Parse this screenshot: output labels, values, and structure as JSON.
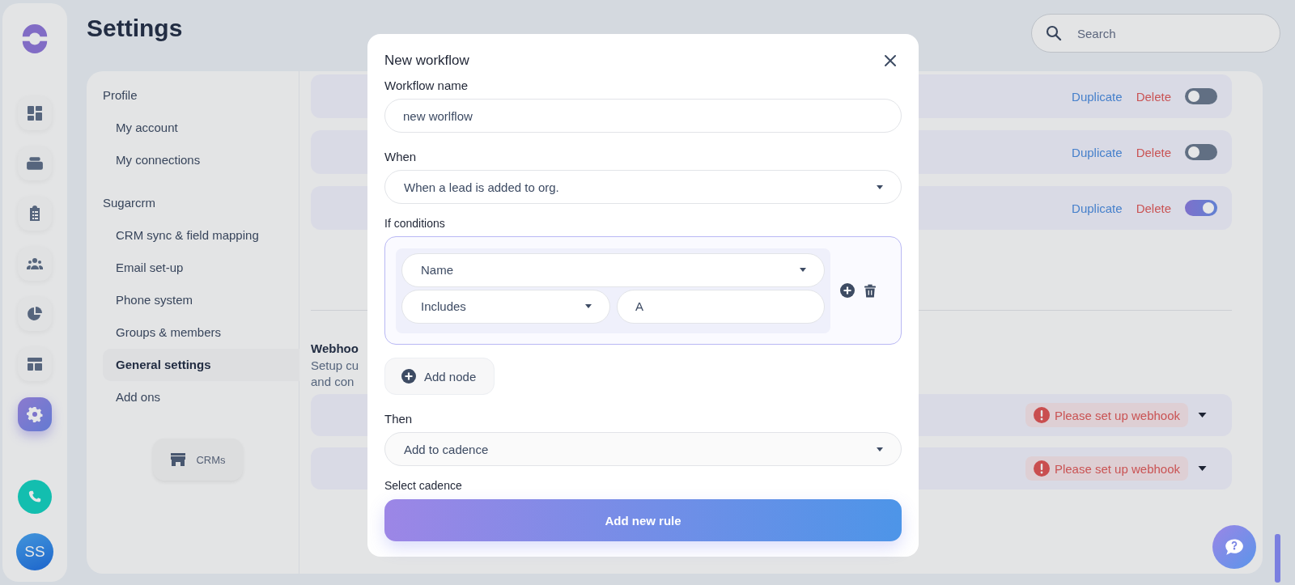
{
  "nav_rail": {
    "items": [
      {
        "kind": "dashboard",
        "selected": false
      },
      {
        "kind": "inbox",
        "selected": false
      },
      {
        "kind": "tasks",
        "selected": false
      },
      {
        "kind": "team",
        "selected": false
      },
      {
        "kind": "reports",
        "selected": false
      },
      {
        "kind": "layout",
        "selected": false
      },
      {
        "kind": "settings",
        "selected": true
      }
    ],
    "avatar": "SS"
  },
  "header": {
    "title": "Settings",
    "search": {
      "placeholder": "Search"
    }
  },
  "settings_nav": {
    "sections": [
      {
        "title": "Profile",
        "items": [
          {
            "label": "My account",
            "selected": false
          },
          {
            "label": "My connections",
            "selected": false
          }
        ]
      },
      {
        "title": "Sugarcrm",
        "items": [
          {
            "label": "CRM sync & field mapping",
            "selected": false
          },
          {
            "label": "Email set-up",
            "selected": false
          },
          {
            "label": "Phone system",
            "selected": false
          },
          {
            "label": "Groups & members",
            "selected": false
          },
          {
            "label": "General settings",
            "selected": true
          },
          {
            "label": "Add ons",
            "selected": false
          }
        ]
      }
    ],
    "crms_button": "CRMs"
  },
  "workflows": [
    {
      "duplicate": "Duplicate",
      "delete": "Delete",
      "on": false
    },
    {
      "duplicate": "Duplicate",
      "delete": "Delete",
      "on": false
    },
    {
      "duplicate": "Duplicate",
      "delete": "Delete",
      "on": true
    }
  ],
  "webhooks": {
    "title": "Webhoo",
    "description": "Setup cu\nand con",
    "rows": [
      {
        "status": "Please set up webhook"
      },
      {
        "status": "Please set up webhook"
      }
    ]
  },
  "modal": {
    "title": "New workflow",
    "name_label": "Workflow name",
    "name_value": "new worlflow",
    "when_label": "When",
    "when_value": "When a lead is added to org.",
    "conditions_label": "If conditions",
    "condition": {
      "field": "Name",
      "operator": "Includes",
      "value": "A"
    },
    "add_node": "Add node",
    "then_label": "Then",
    "then_value": "Add to cadence",
    "cadence_label": "Select cadence",
    "submit": "Add new rule"
  }
}
